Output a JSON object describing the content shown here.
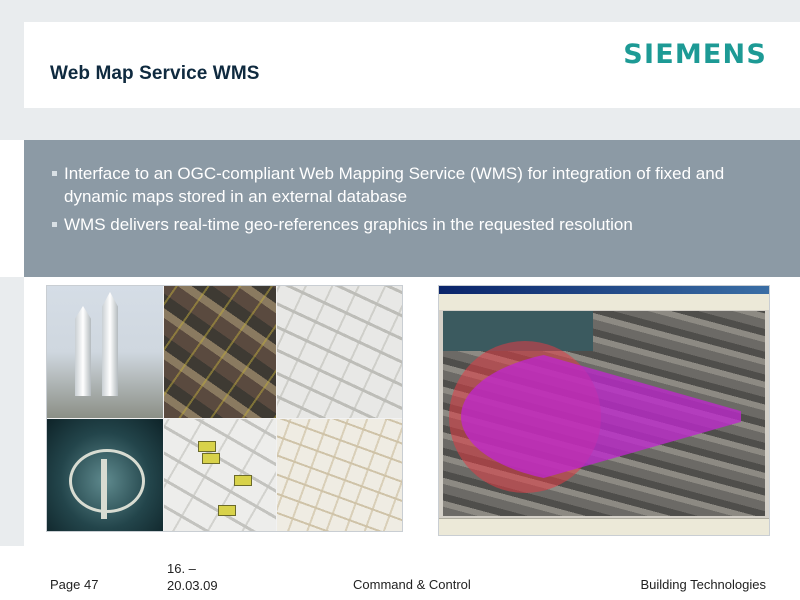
{
  "header": {
    "title": "Web Map Service WMS",
    "logo_text": "SIEMENS",
    "logo_color": "#1d9a95"
  },
  "bullets": [
    "Interface to an OGC-compliant Web Mapping Service (WMS) for integration of fixed and dynamic maps stored in an external database",
    "WMS delivers real-time geo-references graphics in the requested resolution"
  ],
  "footer": {
    "page": "Page 47",
    "date_line1": "16. –",
    "date_line2": "20.03.09",
    "center": "Command & Control",
    "right": "Building Technologies"
  },
  "colors": {
    "title": "#0f2a3f",
    "band": "#8c9aa5"
  }
}
